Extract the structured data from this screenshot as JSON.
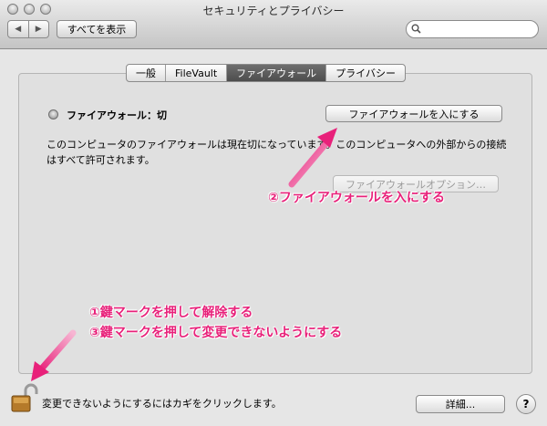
{
  "window": {
    "title": "セキュリティとプライバシー"
  },
  "toolbar": {
    "back_icon": "◀",
    "forward_icon": "▶",
    "show_all_label": "すべてを表示",
    "search_placeholder": "",
    "search_icon": "search-icon"
  },
  "tabs": [
    {
      "label": "一般",
      "active": false
    },
    {
      "label": "FileVault",
      "active": false
    },
    {
      "label": "ファイアウォール",
      "active": true
    },
    {
      "label": "プライバシー",
      "active": false
    }
  ],
  "firewall": {
    "status_label": "ファイアウォール：切",
    "turn_on_button": "ファイアウォールを入にする",
    "description": "このコンピュータのファイアウォールは現在切になっています。このコンピュータへの外部からの接続はすべて許可されます。",
    "options_button": "ファイアウォールオプション…"
  },
  "annotations": {
    "step2": "②ファイアウォールを入にする",
    "step1": "①鍵マークを押して解除する",
    "step3": "③鍵マークを押して変更できないようにする"
  },
  "bottom": {
    "lock_text": "変更できないようにするにはカギをクリックします。",
    "advanced_button": "詳細...",
    "help_label": "?"
  },
  "colors": {
    "annotation": "#e8217a"
  }
}
